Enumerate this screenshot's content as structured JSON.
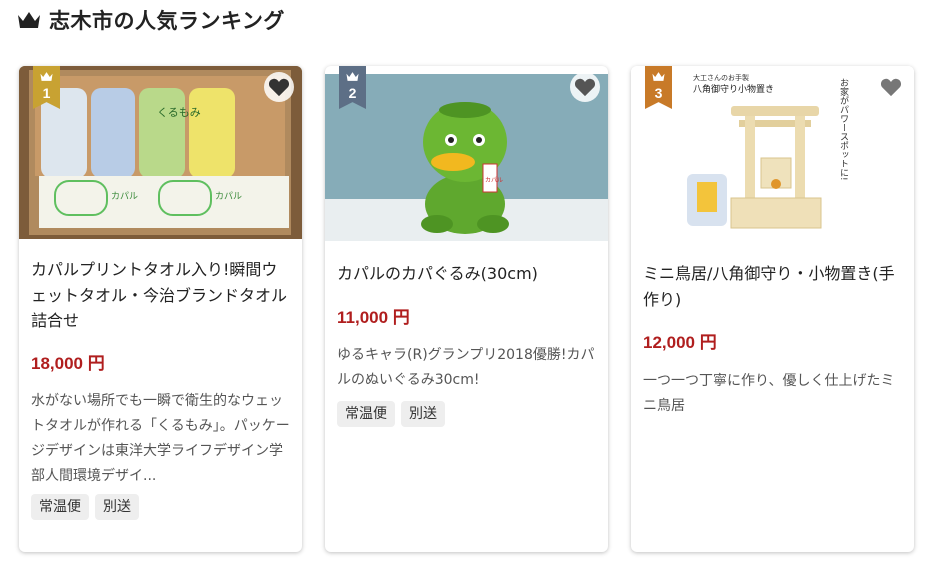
{
  "page": {
    "title": "志木市の人気ランキング",
    "crown_icon": "crown-icon"
  },
  "colors": {
    "price": "#b01e1e",
    "rank1": "#c8a232",
    "rank2": "#5d6f86",
    "rank3": "#c87a28"
  },
  "items": [
    {
      "rank": "1",
      "title": "カパルプリントタオル入り!瞬間ウェットタオル・今治ブランドタオル詰合せ",
      "price": "18,000 円",
      "description": "水がない場所でも一瞬で衛生的なウェットタオルが作れる「くるもみ」。パッケージデザインは東洋大学ライフデザイン学部人間環境デザイ...",
      "tags": [
        "常温便",
        "別送"
      ],
      "image_text": {
        "box_brand": "くるもみ",
        "label": "カパル"
      }
    },
    {
      "rank": "2",
      "title": "カパルのカパぐるみ(30cm)",
      "price": "11,000 円",
      "description": "ゆるキャラ(R)グランプリ2018優勝!カパルのぬいぐるみ30cm!",
      "tags": [
        "常温便",
        "別送"
      ],
      "image_text": {
        "badge": "カパル"
      }
    },
    {
      "rank": "3",
      "title": "ミニ鳥居/八角御守り・小物置き(手作り)",
      "price": "12,000 円",
      "description": "一つ一つ丁寧に作り、優しく仕上げたミニ鳥居",
      "tags": [],
      "image_text": {
        "top_small": "大工さんのお手製",
        "top_main": "八角御守り小物置き",
        "side": "お家がパワースポットに!"
      }
    }
  ]
}
